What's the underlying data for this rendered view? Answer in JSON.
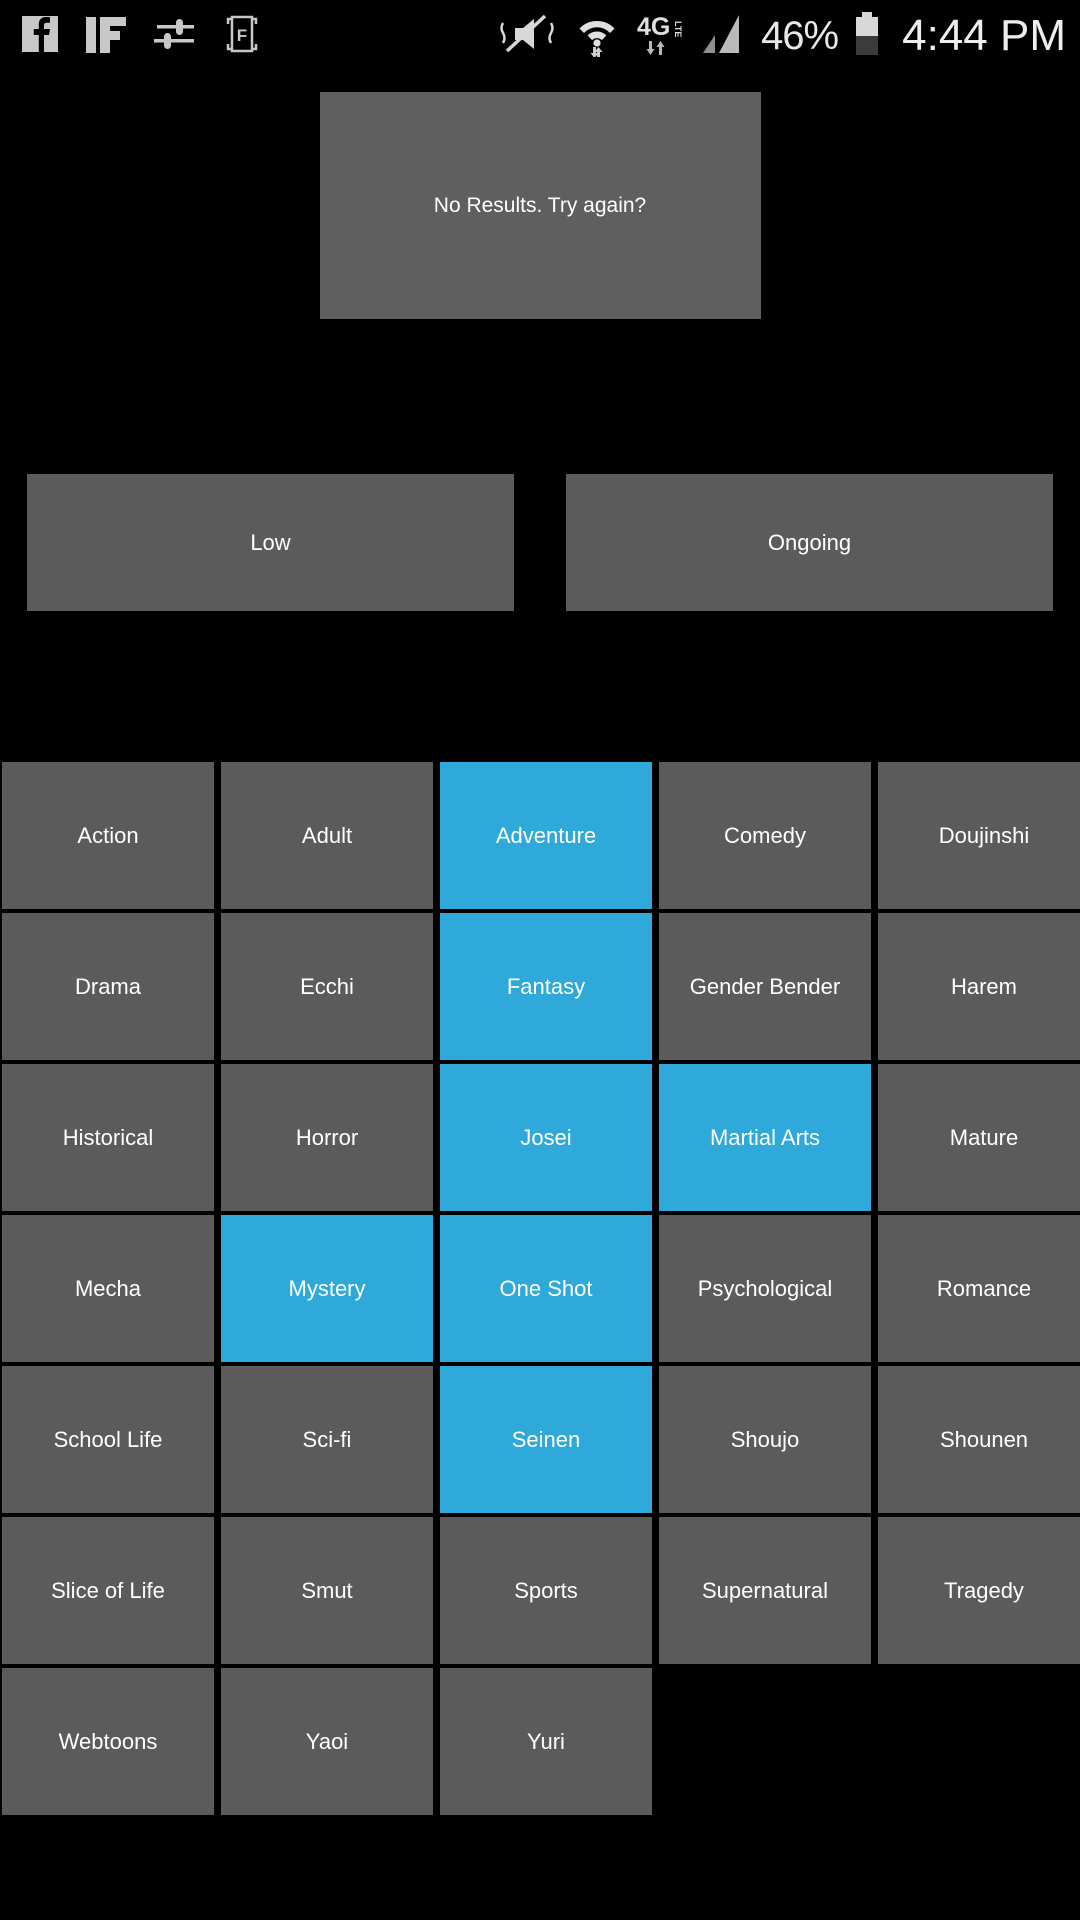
{
  "status_bar": {
    "left_icons": [
      {
        "name": "facebook-icon",
        "glyph": "f"
      },
      {
        "name": "if-app-icon",
        "glyph": "IF"
      },
      {
        "name": "equalizer-sliders-icon",
        "glyph": "sliders"
      },
      {
        "name": "f-bracket-icon",
        "glyph": "F"
      }
    ],
    "right_icons": [
      {
        "name": "vibrate-mute-icon"
      },
      {
        "name": "wifi-icon"
      },
      {
        "name": "4g-lte-icon",
        "label": "4G"
      },
      {
        "name": "cellular-signal-icon"
      }
    ],
    "battery_percent": "46%",
    "clock": "4:44 PM"
  },
  "results_panel": {
    "message": "No Results. Try again?"
  },
  "filters": {
    "rating_label": "Low",
    "status_label": "Ongoing"
  },
  "colors": {
    "background": "#000000",
    "tile": "#5b5b5b",
    "tile_selected": "#2fa8da",
    "text": "#ffffff"
  },
  "genres": [
    {
      "label": "Action",
      "selected": false
    },
    {
      "label": "Adult",
      "selected": false
    },
    {
      "label": "Adventure",
      "selected": true
    },
    {
      "label": "Comedy",
      "selected": false
    },
    {
      "label": "Doujinshi",
      "selected": false
    },
    {
      "label": "Drama",
      "selected": false
    },
    {
      "label": "Ecchi",
      "selected": false
    },
    {
      "label": "Fantasy",
      "selected": true
    },
    {
      "label": "Gender Bender",
      "selected": false
    },
    {
      "label": "Harem",
      "selected": false
    },
    {
      "label": "Historical",
      "selected": false
    },
    {
      "label": "Horror",
      "selected": false
    },
    {
      "label": "Josei",
      "selected": true
    },
    {
      "label": "Martial Arts",
      "selected": true
    },
    {
      "label": "Mature",
      "selected": false
    },
    {
      "label": "Mecha",
      "selected": false
    },
    {
      "label": "Mystery",
      "selected": true
    },
    {
      "label": "One Shot",
      "selected": true
    },
    {
      "label": "Psychological",
      "selected": false
    },
    {
      "label": "Romance",
      "selected": false
    },
    {
      "label": "School Life",
      "selected": false
    },
    {
      "label": "Sci-fi",
      "selected": false
    },
    {
      "label": "Seinen",
      "selected": true
    },
    {
      "label": "Shoujo",
      "selected": false
    },
    {
      "label": "Shounen",
      "selected": false
    },
    {
      "label": "Slice of Life",
      "selected": false
    },
    {
      "label": "Smut",
      "selected": false
    },
    {
      "label": "Sports",
      "selected": false
    },
    {
      "label": "Supernatural",
      "selected": false
    },
    {
      "label": "Tragedy",
      "selected": false
    },
    {
      "label": "Webtoons",
      "selected": false
    },
    {
      "label": "Yaoi",
      "selected": false
    },
    {
      "label": "Yuri",
      "selected": false
    }
  ]
}
